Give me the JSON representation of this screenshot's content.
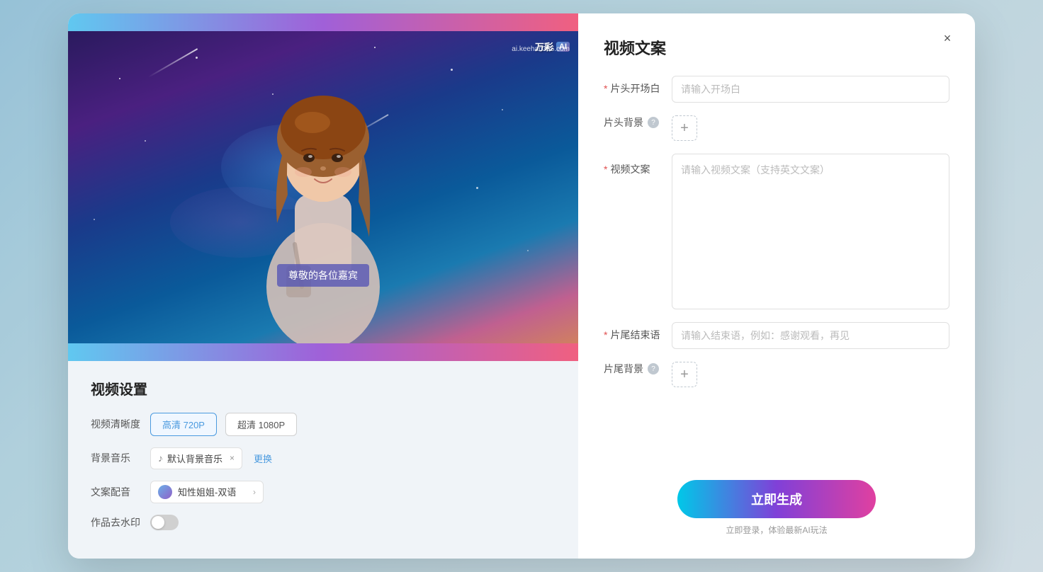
{
  "modal": {
    "close_label": "×"
  },
  "left": {
    "watermark_brand": "万彩",
    "watermark_ai": "AI",
    "watermark_domain": "ai.keehan365.com",
    "subtitle_text": "尊敬的各位嘉宾",
    "settings_title": "视频设置",
    "quality_label": "视频清晰度",
    "quality_options": [
      {
        "label": "高清 720P",
        "active": true
      },
      {
        "label": "超清 1080P",
        "active": false
      }
    ],
    "music_label": "背景音乐",
    "music_default": "默认背景音乐",
    "music_replace": "更换",
    "voice_label": "文案配音",
    "voice_name": "知性姐姐-双语",
    "watermark_label": "作品去水印",
    "watermark_toggle": false
  },
  "right": {
    "panel_title": "视频文案",
    "intro_label": "片头开场白",
    "intro_required": true,
    "intro_placeholder": "请输入开场白",
    "header_bg_label": "片头背景",
    "header_bg_help": true,
    "video_copy_label": "视频文案",
    "video_copy_required": true,
    "video_copy_placeholder": "请输入视频文案（支持英文文案）",
    "outro_label": "片尾结束语",
    "outro_required": true,
    "outro_placeholder": "请输入结束语，例如：感谢观看，再见",
    "footer_bg_label": "片尾背景",
    "footer_bg_help": true,
    "generate_btn_label": "立即生成",
    "generate_hint": "立即登录，体验最新AI玩法"
  }
}
